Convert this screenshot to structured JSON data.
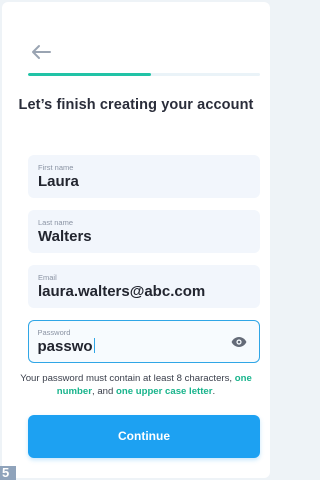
{
  "header": {
    "back_icon": "arrow-left-icon",
    "progress_fraction": 0.53,
    "title": "Let’s finish creating your account"
  },
  "form": {
    "first_name": {
      "label": "First name",
      "value": "Laura"
    },
    "last_name": {
      "label": "Last name",
      "value": "Walters"
    },
    "email": {
      "label": "Email",
      "value": "laura.walters@abc.com"
    },
    "password": {
      "label": "Password",
      "value": "passwo",
      "toggle_icon": "eye-icon"
    }
  },
  "hint": {
    "part1": "Your password must contain at least 8 characters, ",
    "highlight1": "one number",
    "part2": ", and ",
    "highlight2": "one upper case letter",
    "part3": "."
  },
  "actions": {
    "continue_label": "Continue"
  },
  "badge": {
    "text": "5"
  },
  "colors": {
    "accent": "#1da1f2",
    "progress": "#21c3a6",
    "highlight_text": "#19b48c",
    "field_bg": "#f2f6fc"
  }
}
